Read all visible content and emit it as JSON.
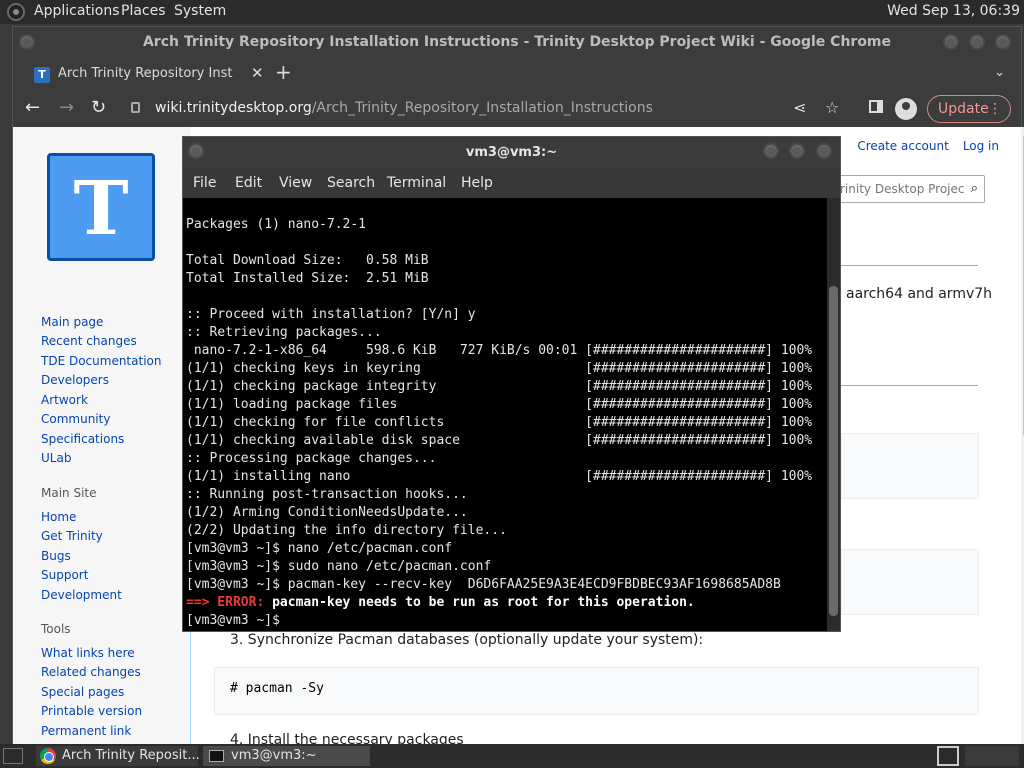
{
  "desktop": {
    "menu": [
      "Applications",
      "Places",
      "System"
    ],
    "clock": "Wed Sep 13, 06:39"
  },
  "browser": {
    "window_title": "Arch Trinity Repository Installation Instructions - Trinity Desktop Project Wiki - Google Chrome",
    "tab_title": "Arch Trinity Repository Installa",
    "tab_close": "✕",
    "new_tab": "+",
    "tabs_menu": "⌄",
    "url_domain": "wiki.trinitydesktop.org",
    "url_path": "/Arch_Trinity_Repository_Installation_Instructions",
    "update_label": "Update",
    "menu_dots": "⋮"
  },
  "wiki": {
    "top_links": [
      "Create account",
      "Log in"
    ],
    "search_placeholder": "rinity Desktop Projec",
    "logo_letter": "T",
    "nav_links": [
      "Main page",
      "Recent changes",
      "TDE Documentation",
      "Developers",
      "Artwork",
      "Community",
      "Specifications",
      "ULab"
    ],
    "main_site_heading": "Main Site",
    "main_site_links": [
      "Home",
      "Get Trinity",
      "Bugs",
      "Support",
      "Development"
    ],
    "tools_heading": "Tools",
    "tools_links": [
      "What links here",
      "Related changes",
      "Special pages",
      "Printable version",
      "Permanent link"
    ],
    "arch_fragment": "aarch64 and armv7h",
    "step3": "3. Synchronize Pacman databases (optionally update your system):",
    "step3_code": "# pacman -Sy",
    "step4": "4. Install the necessary packages"
  },
  "terminal": {
    "title": "vm3@vm3:~",
    "menu": [
      "File",
      "Edit",
      "View",
      "Search",
      "Terminal",
      "Help"
    ],
    "lines": [
      "Packages (1) nano-7.2-1",
      "",
      "Total Download Size:   0.58 MiB",
      "Total Installed Size:  2.51 MiB",
      "",
      ":: Proceed with installation? [Y/n] y",
      ":: Retrieving packages...",
      " nano-7.2-1-x86_64     598.6 KiB   727 KiB/s 00:01 [######################] 100%",
      "(1/1) checking keys in keyring                     [######################] 100%",
      "(1/1) checking package integrity                   [######################] 100%",
      "(1/1) loading package files                        [######################] 100%",
      "(1/1) checking for file conflicts                  [######################] 100%",
      "(1/1) checking available disk space                [######################] 100%",
      ":: Processing package changes...",
      "(1/1) installing nano                              [######################] 100%",
      ":: Running post-transaction hooks...",
      "(1/2) Arming ConditionNeedsUpdate...",
      "(2/2) Updating the info directory file...",
      "[vm3@vm3 ~]$ nano /etc/pacman.conf",
      "[vm3@vm3 ~]$ sudo nano /etc/pacman.conf",
      "[vm3@vm3 ~]$ pacman-key --recv-key  D6D6FAA25E9A3E4ECD9FBDBEC93AF1698685AD8B"
    ],
    "error_prefix": "==> ERROR:",
    "error_message": " pacman-key needs to be run as root for this operation.",
    "prompt": "[vm3@vm3 ~]$ "
  },
  "taskbar": {
    "tasks": [
      "Arch Trinity Reposit...",
      "vm3@vm3:~"
    ]
  },
  "colors": {
    "accent_link": "#0645ad",
    "error_red": "#e83a3a",
    "update_pill": "#f29b94"
  }
}
